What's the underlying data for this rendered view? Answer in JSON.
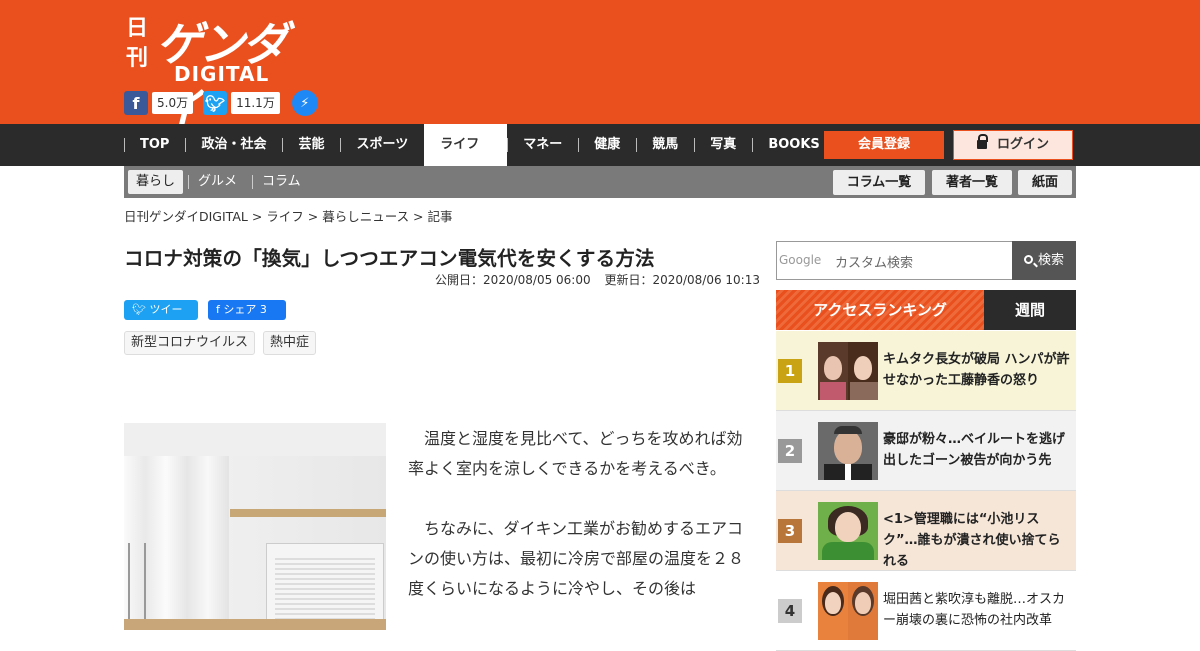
{
  "brand": {
    "kanji": "日刊",
    "name": "ゲンダイ",
    "sub": "DIGITAL",
    "color": "#e9501e"
  },
  "social": {
    "facebook_count": "5.0万",
    "twitter_count": "11.1万"
  },
  "nav": {
    "items": [
      "TOP",
      "政治・社会",
      "芸能",
      "スポーツ",
      "ライフ",
      "マネー",
      "健康",
      "競馬",
      "写真",
      "BOOKS"
    ],
    "active": "ライフ",
    "register": "会員登録",
    "login": "ログイン"
  },
  "subnav": {
    "items": [
      "暮らし",
      "グルメ",
      "コラム"
    ],
    "buttons": [
      "コラム一覧",
      "著者一覧",
      "紙面"
    ]
  },
  "breadcrumb": "日刊ゲンダイDIGITAL > ライフ > 暮らしニュース > 記事",
  "article": {
    "title": "コロナ対策の「換気」しつつエアコン電気代を安くする方法",
    "published": "公開日：2020/08/05 06:00",
    "updated": "更新日：2020/08/06 10:13",
    "tweet": "ツイート",
    "share": "シェア 3",
    "tags": [
      "新型コロナウイルス",
      "熱中症"
    ],
    "paragraphs": [
      "温度と湿度を見比べて、どっちを攻めれば効率よく室内を涼しくできるかを考えるべき。",
      "ちなみに、ダイキン工業がお勧めするエアコンの使い方は、最初に冷房で部屋の温度を２８度くらいになるように冷やし、その後は"
    ]
  },
  "search": {
    "google_label": "Google",
    "placeholder": "カスタム検索",
    "button": "検索"
  },
  "ranking": {
    "tab_access": "アクセスランキング",
    "tab_weekly": "週間",
    "items": [
      {
        "rank": "1",
        "title": "キムタク長女が破局 ハンパが許せなかった工藤静香の怒り"
      },
      {
        "rank": "2",
        "title": "豪邸が粉々…ベイルートを逃げ出したゴーン被告が向かう先"
      },
      {
        "rank": "3",
        "title": "<1>管理職には“小池リスク”…誰もが潰され使い捨てられる"
      },
      {
        "rank": "4",
        "title": "堀田茜と紫吹淳も離脱…オスカー崩壊の裏に恐怖の社内改革"
      }
    ]
  }
}
